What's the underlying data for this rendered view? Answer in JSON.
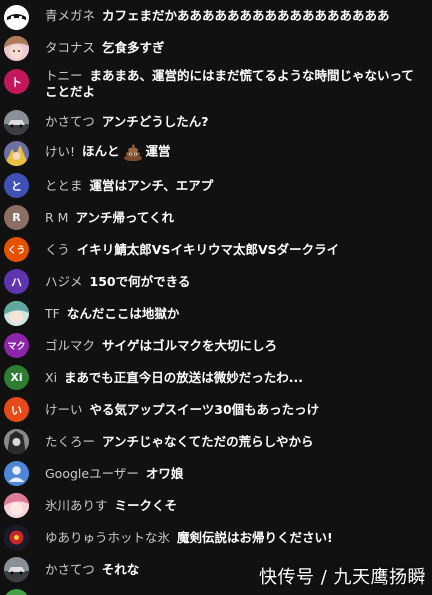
{
  "messages": [
    {
      "author": "青メガネ",
      "text": "カフェまだかあああああああああああああああああ",
      "avatar_icon": "eye-mask-icon",
      "avatar_color": "#ffffff"
    },
    {
      "author": "タコナス",
      "text": "乞食多すぎ",
      "avatar_icon": "anime-girl-icon",
      "avatar_color": "#d9a5b5"
    },
    {
      "author": "トニー",
      "text": "まあまあ、運営的にはまだ慌てるような時間じゃないってことだよ",
      "avatar_initial": "ト",
      "avatar_color": "#c2185b"
    },
    {
      "author": "かさてつ",
      "text": "アンチどうしたん?",
      "avatar_icon": "car-photo-icon",
      "avatar_color": "#5a6068"
    },
    {
      "author": "けい!",
      "text_before": "ほんと",
      "text_after": "運営",
      "avatar_icon": "anime-character-icon",
      "avatar_color": "#4a5070",
      "emoji": "poop-emoji"
    },
    {
      "author": "ととま",
      "text": "運営はアンチ、エアプ",
      "avatar_initial": "と",
      "avatar_color": "#3f51b5"
    },
    {
      "author": "R M",
      "text": "アンチ帰ってくれ",
      "avatar_initial": "R",
      "avatar_color": "#8d6e63"
    },
    {
      "author": "くう",
      "text": "イキリ鯖太郎VSイキリウマ太郎VSダークライ",
      "avatar_initial": "くう",
      "avatar_color": "#e65100"
    },
    {
      "author": "ハジメ",
      "text": "150で何ができる",
      "avatar_initial": "ハ",
      "avatar_color": "#5e35b1"
    },
    {
      "author": "TF",
      "text": "なんだここは地獄か",
      "avatar_icon": "anime-girl-teal-icon",
      "avatar_color": "#7fb8b0"
    },
    {
      "author": "ゴルマク",
      "text": "サイゲはゴルマクを大切にしろ",
      "avatar_initial": "マク",
      "avatar_color": "#8e24aa"
    },
    {
      "author": "Xi",
      "text": "まあでも正直今日の放送は微妙だったわ...",
      "avatar_initial": "Xi",
      "avatar_color": "#2e7d32"
    },
    {
      "author": "けーい",
      "text": "やる気アップスイーツ30個もあったっけ",
      "avatar_initial": "い",
      "avatar_color": "#e64a19"
    },
    {
      "author": "たくろー",
      "text": "アンチじゃなくてただの荒らしやから",
      "avatar_icon": "dark-character-icon",
      "avatar_color": "#6d6d6d"
    },
    {
      "author": "Googleユーザー",
      "text": "オワ娘",
      "avatar_icon": "default-user-icon",
      "avatar_color": "#4f86d6"
    },
    {
      "author": "氷川ありす",
      "text": "ミークくそ",
      "avatar_icon": "pink-anime-icon",
      "avatar_color": "#f2b6c6"
    },
    {
      "author": "ゆありゅうホットな氷",
      "text": "魔剣伝説はお帰りください!",
      "avatar_icon": "red-flower-icon",
      "avatar_color": "#c62828"
    },
    {
      "author": "かさてつ",
      "text": "それな",
      "avatar_icon": "car-photo-icon",
      "avatar_color": "#5a6068"
    }
  ],
  "watermark": "快传号 / 九天鹰扬瞬"
}
